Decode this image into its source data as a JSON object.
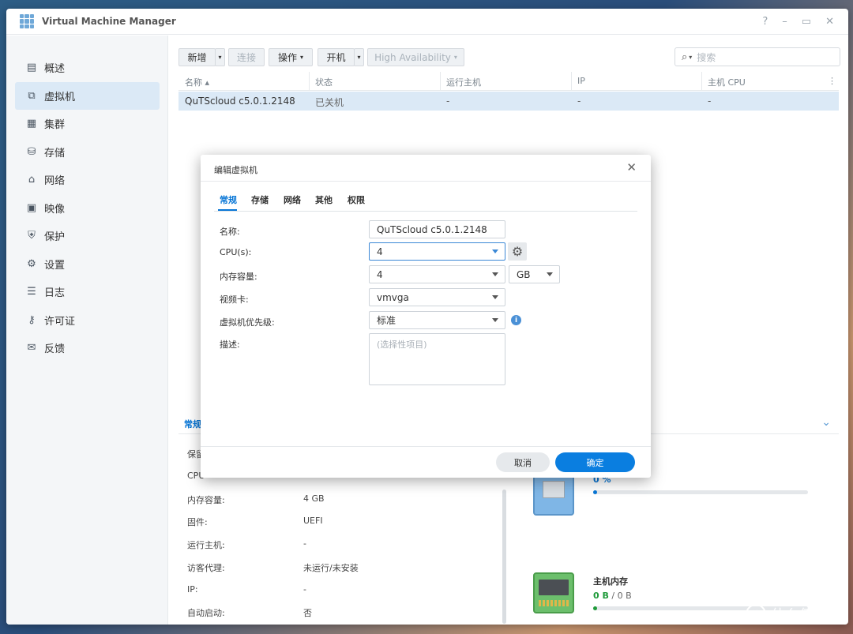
{
  "window": {
    "title": "Virtual Machine Manager",
    "controls": [
      "?",
      "–",
      "▭",
      "✕"
    ]
  },
  "sidebar": {
    "items": [
      {
        "label": "概述",
        "icon": "overview-icon",
        "glyph": "▤"
      },
      {
        "label": "虚拟机",
        "icon": "vm-icon",
        "glyph": "⧉"
      },
      {
        "label": "集群",
        "icon": "cluster-icon",
        "glyph": "▦"
      },
      {
        "label": "存储",
        "icon": "storage-icon",
        "glyph": "⛁"
      },
      {
        "label": "网络",
        "icon": "network-icon",
        "glyph": "⌂"
      },
      {
        "label": "映像",
        "icon": "image-icon",
        "glyph": "▣"
      },
      {
        "label": "保护",
        "icon": "shield-icon",
        "glyph": "⛨"
      },
      {
        "label": "设置",
        "icon": "gear-icon",
        "glyph": "⚙"
      },
      {
        "label": "日志",
        "icon": "list-icon",
        "glyph": "☰"
      },
      {
        "label": "许可证",
        "icon": "key-icon",
        "glyph": "⚷"
      },
      {
        "label": "反馈",
        "icon": "mail-icon",
        "glyph": "✉"
      }
    ],
    "active_index": 1
  },
  "toolbar": {
    "add": "新增",
    "connect": "连接",
    "action": "操作",
    "power_on": "开机",
    "high_availability": "High Availability",
    "search_placeholder": "搜索"
  },
  "table": {
    "columns": [
      "名称",
      "状态",
      "运行主机",
      "IP",
      "主机 CPU"
    ],
    "sort_indicator": "▴",
    "rows": [
      {
        "name": "QuTScloud c5.0.1.2148",
        "status": "已关机",
        "host": "-",
        "ip": "-",
        "cpu": "-"
      }
    ]
  },
  "lower_panel": {
    "tab": "常规",
    "props": [
      {
        "label": "保留",
        "value": ""
      },
      {
        "label": "CPU",
        "value": ""
      },
      {
        "label": "内存容量:",
        "value": "4 GB"
      },
      {
        "label": "固件:",
        "value": "UEFI"
      },
      {
        "label": "运行主机:",
        "value": "-"
      },
      {
        "label": "访客代理:",
        "value": "未运行/未安装"
      },
      {
        "label": "IP:",
        "value": "-"
      },
      {
        "label": "自动启动:",
        "value": "否"
      }
    ],
    "cpu_resource": {
      "value_text": "0 %",
      "fill_fraction": 0.02
    },
    "memory_resource": {
      "title": "主机内存",
      "used": "0 B",
      "separator": "/",
      "total": "0 B",
      "fill_fraction": 0.02
    }
  },
  "dialog": {
    "title": "编辑虚拟机",
    "tabs": [
      "常规",
      "存储",
      "网络",
      "其他",
      "权限"
    ],
    "active_tab": 0,
    "fields": {
      "name": {
        "label": "名称:",
        "value": "QuTScloud c5.0.1.2148"
      },
      "cpu": {
        "label": "CPU(s):",
        "value": "4"
      },
      "memory": {
        "label": "内存容量:",
        "value": "4",
        "unit": "GB"
      },
      "video": {
        "label": "视频卡:",
        "value": "vmvga"
      },
      "priority": {
        "label": "虚拟机优先级:",
        "value": "标准"
      },
      "description": {
        "label": "描述:",
        "placeholder": "(选择性项目)"
      }
    },
    "cancel": "取消",
    "ok": "确定"
  },
  "watermark": {
    "text": "什么值得买",
    "badge": "值"
  },
  "colors": {
    "accent": "#0876d6",
    "selected_row": "#dbe9f6",
    "ok_button": "#0a7ee0"
  }
}
